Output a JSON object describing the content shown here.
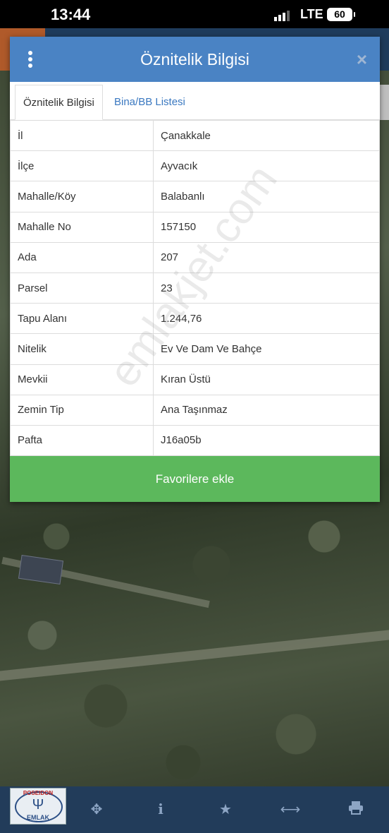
{
  "status_bar": {
    "time": "13:44",
    "network": "LTE",
    "battery": "60"
  },
  "modal": {
    "title": "Öznitelik Bilgisi",
    "close_label": "×",
    "tabs": [
      {
        "label": "Öznitelik Bilgisi",
        "active": true
      },
      {
        "label": "Bina/BB Listesi",
        "active": false
      }
    ],
    "rows": [
      {
        "key": "İl",
        "value": "Çanakkale"
      },
      {
        "key": "İlçe",
        "value": "Ayvacık"
      },
      {
        "key": "Mahalle/Köy",
        "value": "Balabanlı"
      },
      {
        "key": "Mahalle No",
        "value": "157150"
      },
      {
        "key": "Ada",
        "value": "207"
      },
      {
        "key": "Parsel",
        "value": "23"
      },
      {
        "key": "Tapu Alanı",
        "value": "1.244,76"
      },
      {
        "key": "Nitelik",
        "value": "Ev Ve Dam Ve Bahçe"
      },
      {
        "key": "Mevkii",
        "value": "Kıran Üstü"
      },
      {
        "key": "Zemin Tip",
        "value": "Ana Taşınmaz"
      },
      {
        "key": "Pafta",
        "value": "J16a05b"
      }
    ],
    "favorite_button": "Favorilere ekle"
  },
  "watermark": "emlakjet.com",
  "logo": {
    "top_text": "POSEIDON",
    "bottom_text": "EMLAK"
  },
  "toolbar": {
    "icons": [
      "crosshair-icon",
      "info-icon",
      "star-icon",
      "arrows-horizontal-icon",
      "print-icon"
    ]
  },
  "colors": {
    "header": "#4a83c4",
    "button": "#5cb85c",
    "toolbar": "#223c5a",
    "tab_link": "#3a78c0"
  }
}
